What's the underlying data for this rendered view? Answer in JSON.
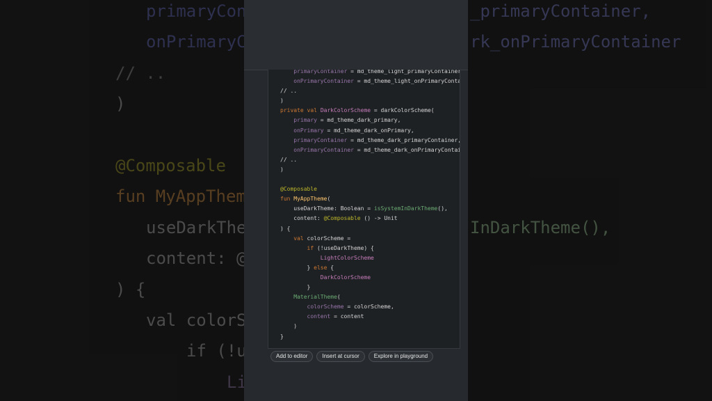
{
  "background_left": [
    {
      "text": "primaryCon",
      "tone": "prop"
    },
    {
      "text": "onPrimaryCo",
      "tone": "prop"
    },
    {
      "text": "// ..",
      "tone": "plain"
    },
    {
      "text": ")",
      "tone": "plain"
    },
    {
      "text": "@Composable",
      "tone": "ann"
    },
    {
      "text": "fun MyAppThem",
      "tone": "fun"
    },
    {
      "text": "useDarkThe",
      "tone": "plain"
    },
    {
      "text": "content: @",
      "tone": "plain"
    },
    {
      "text": ") {",
      "tone": "plain"
    },
    {
      "text": "val colorS",
      "tone": "plain"
    },
    {
      "text": "if (!u",
      "tone": "plain"
    },
    {
      "text": "Li",
      "tone": "prop"
    }
  ],
  "background_right": [
    {
      "text": "_primaryContainer,",
      "tone": "grn"
    },
    {
      "text": "rk_onPrimaryContainer",
      "tone": "grn"
    },
    {
      "text": "InDarkTheme(),",
      "tone": "grn"
    }
  ],
  "code_lines": [
    "    primaryContainer = md_theme_light_primaryContainer,",
    "    onPrimaryContainer = md_theme_light_onPrimaryContainer,",
    "// ..",
    ")",
    "private val DarkColorScheme = darkColorScheme(",
    "    primary = md_theme_dark_primary,",
    "    onPrimary = md_theme_dark_onPrimary,",
    "    primaryContainer = md_theme_dark_primaryContainer,",
    "    onPrimaryContainer = md_theme_dark_onPrimaryContainer,",
    "// ..",
    ")",
    "",
    "@Composable",
    "fun MyAppTheme(",
    "    useDarkTheme: Boolean = isSystemInDarkTheme(),",
    "    content: @Composable () -> Unit",
    ") {",
    "    val colorScheme =",
    "        if (!useDarkTheme) {",
    "            LightColorScheme",
    "        } else {",
    "            DarkColorScheme",
    "        }",
    "    MaterialTheme(",
    "        colorScheme = colorScheme,",
    "        content = content",
    "    )",
    "}"
  ],
  "actions": {
    "add_to_editor": "Add to editor",
    "insert_at_cursor": "Insert at cursor",
    "explore_in_playground": "Explore in playground"
  },
  "colors": {
    "keyword": "#cc7832",
    "function": "#ffc66d",
    "annotation": "#bbb529",
    "property": "#9876aa",
    "call": "#6aab73"
  }
}
